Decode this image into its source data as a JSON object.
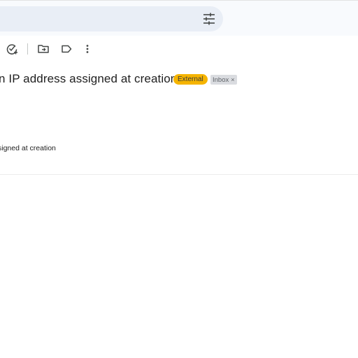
{
  "header": {
    "search_options_icon": "tune-icon"
  },
  "toolbar": {
    "icons": [
      "add-task-icon",
      "move-to-icon",
      "label-icon",
      "more-vert-icon"
    ]
  },
  "message": {
    "subject": "n IP address assigned at creation",
    "labels": {
      "external": "External",
      "inbox": "Inbox",
      "inbox_remove": "×"
    },
    "snippet": "signed at creation"
  },
  "colors": {
    "external_badge": "#f5b400",
    "inbox_badge": "#dadce0",
    "search_bg": "#e9eef6"
  }
}
